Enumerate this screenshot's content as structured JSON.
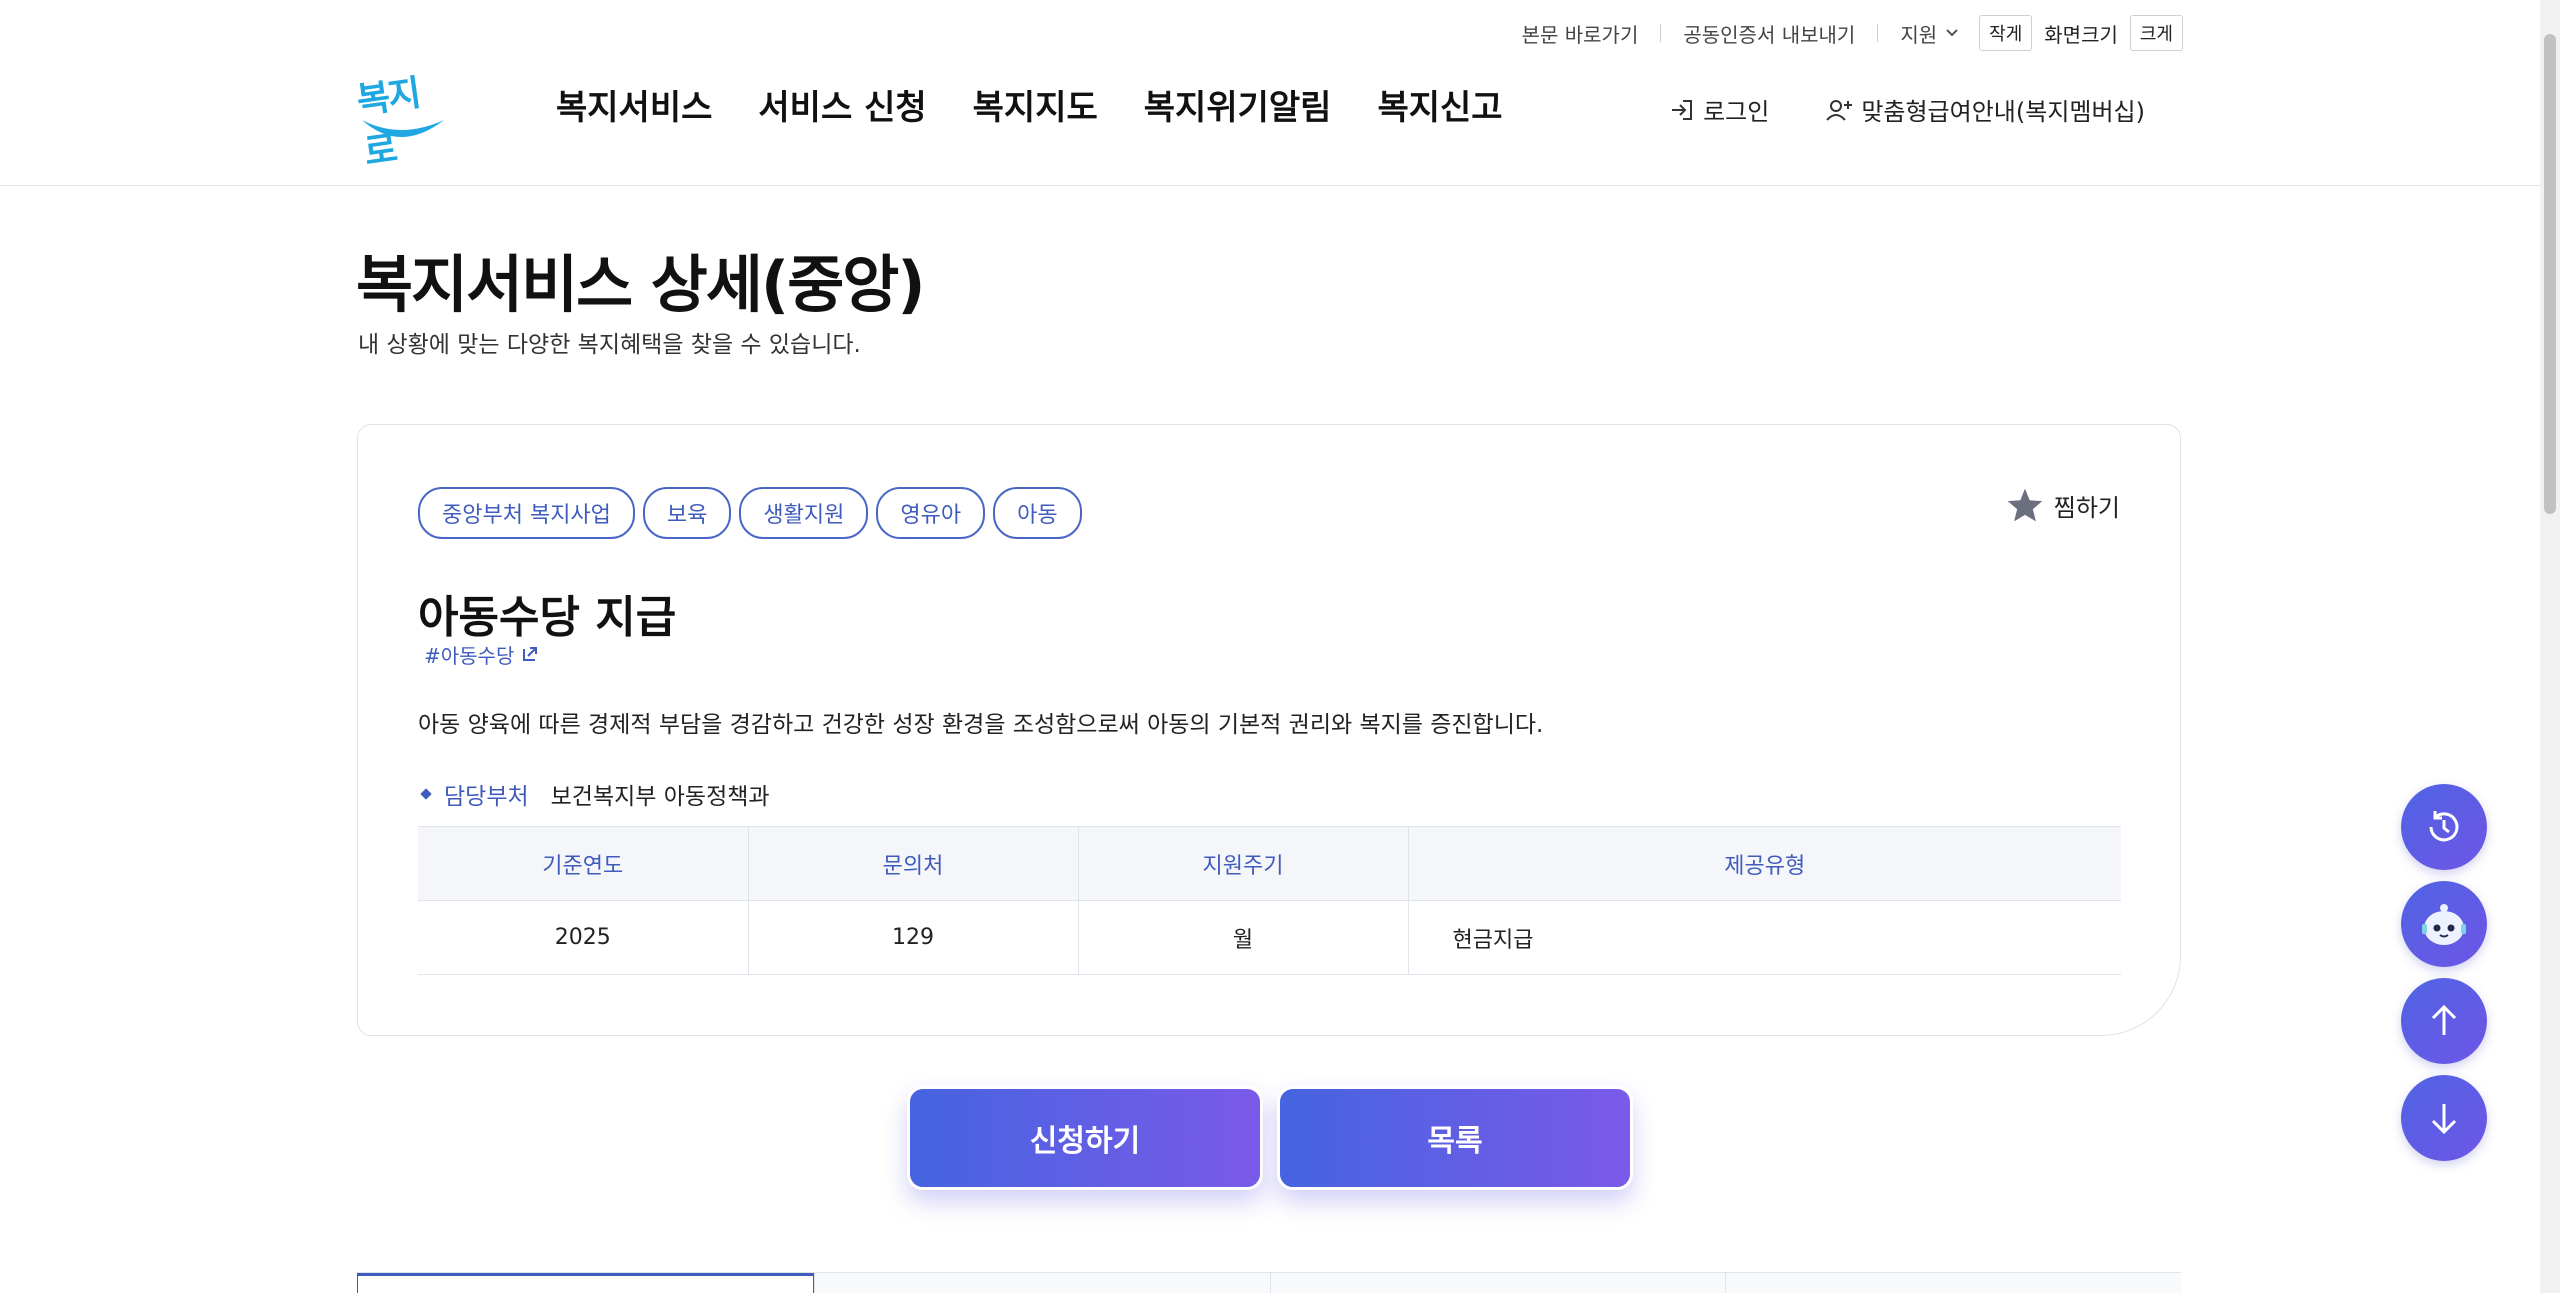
{
  "utility": {
    "skip_to_content": "본문 바로가기",
    "export_cert": "공동인증서 내보내기",
    "language": "지원",
    "font_small": "작게",
    "font_label": "화면크기",
    "font_large": "크게"
  },
  "header": {
    "logo_text": "복지로",
    "nav": [
      "복지서비스",
      "서비스 신청",
      "복지지도",
      "복지위기알림",
      "복지신고"
    ],
    "login": "로그인",
    "membership": "맞춤형급여안내(복지멤버십)"
  },
  "page": {
    "title": "복지서비스 상세(중앙)",
    "subtitle": "내 상황에 맞는 다양한 복지혜택을 찾을 수 있습니다."
  },
  "service": {
    "tags": [
      "중앙부처 복지사업",
      "보육",
      "생활지원",
      "영유아",
      "아동"
    ],
    "favorite": "찜하기",
    "title": "아동수당 지급",
    "hashtag": "#아동수당",
    "description": "아동 양육에 따른 경제적 부담을 경감하고 건강한 성장 환경을 조성함으로써 아동의 기본적 권리와 복지를 증진합니다.",
    "dept_label": "담당부처",
    "dept_value": "보건복지부 아동정책과",
    "table": {
      "headers": [
        "기준연도",
        "문의처",
        "지원주기",
        "제공유형"
      ],
      "row": [
        "2025",
        "129",
        "월",
        "현금지급"
      ]
    }
  },
  "buttons": {
    "apply": "신청하기",
    "list": "목록"
  },
  "icons": {
    "recent": "history-icon",
    "chatbot": "chatbot-icon",
    "top": "arrow-up-icon",
    "bottom": "arrow-down-icon"
  }
}
